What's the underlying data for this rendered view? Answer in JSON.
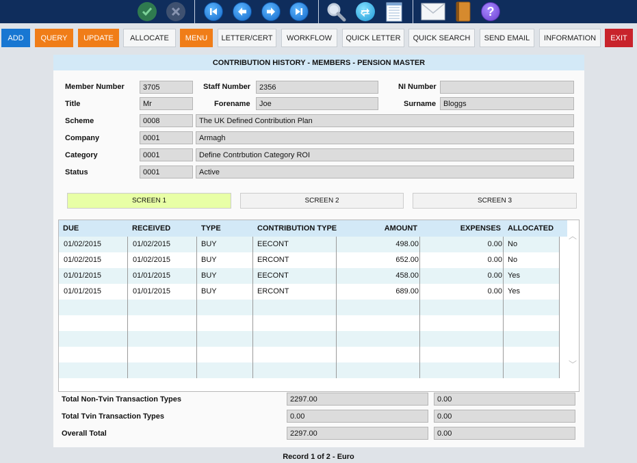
{
  "toolbar_icons": [
    "confirm-icon",
    "cancel-icon",
    "first-record-icon",
    "previous-record-icon",
    "next-record-icon",
    "last-record-icon",
    "search-icon",
    "refresh-icon",
    "notepad-icon",
    "mail-icon",
    "address-book-icon",
    "help-icon"
  ],
  "buttons": {
    "add": "ADD",
    "query": "QUERY",
    "update": "UPDATE",
    "allocate": "ALLOCATE",
    "menu": "MENU",
    "letter_cert": "LETTER/CERT",
    "workflow": "WORKFLOW",
    "quick_letter": "QUICK LETTER",
    "quick_search": "QUICK SEARCH",
    "send_email": "SEND EMAIL",
    "information": "INFORMATION",
    "exit": "EXIT"
  },
  "colors": {
    "toolbar_bg": "#0f2d5c",
    "accent_blue": "#1877d2",
    "accent_orange": "#f07d18",
    "accent_red": "#c8232b",
    "header_blue": "#d3e9f7",
    "active_tab": "#e8ffa6"
  },
  "panel": {
    "title": "CONTRIBUTION HISTORY - MEMBERS - PENSION MASTER"
  },
  "member": {
    "member_number_label": "Member Number",
    "member_number": "3705",
    "staff_number_label": "Staff Number",
    "staff_number": "2356",
    "ni_number_label": "NI Number",
    "ni_number": "",
    "title_label": "Title",
    "title": "Mr",
    "forename_label": "Forename",
    "forename": "Joe",
    "surname_label": "Surname",
    "surname": "Bloggs",
    "scheme_label": "Scheme",
    "scheme_code": "0008",
    "scheme_name": "The UK Defined Contribution Plan",
    "company_label": "Company",
    "company_code": "0001",
    "company_name": "Armagh",
    "category_label": "Category",
    "category_code": "0001",
    "category_name": "Define Contrbution Category ROI",
    "status_label": "Status",
    "status_code": "0001",
    "status_name": "Active"
  },
  "tabs": [
    "SCREEN 1",
    "SCREEN 2",
    "SCREEN 3"
  ],
  "grid": {
    "headers": [
      "DUE",
      "RECEIVED",
      "TYPE",
      "CONTRIBUTION TYPE",
      "AMOUNT",
      "EXPENSES",
      "ALLOCATED"
    ],
    "rows": [
      [
        "01/02/2015",
        "01/02/2015",
        "BUY",
        "EECONT",
        "498.00",
        "0.00",
        "No"
      ],
      [
        "01/02/2015",
        "01/02/2015",
        "BUY",
        "ERCONT",
        "652.00",
        "0.00",
        "No"
      ],
      [
        "01/01/2015",
        "01/01/2015",
        "BUY",
        "EECONT",
        "458.00",
        "0.00",
        "Yes"
      ],
      [
        "01/01/2015",
        "01/01/2015",
        "BUY",
        "ERCONT",
        "689.00",
        "0.00",
        "Yes"
      ]
    ]
  },
  "totals": {
    "non_tvin_label": "Total Non-Tvin Transaction Types",
    "non_tvin_amount": "2297.00",
    "non_tvin_expenses": "0.00",
    "tvin_label": "Total Tvin Transaction Types",
    "tvin_amount": "0.00",
    "tvin_expenses": "0.00",
    "overall_label": "Overall Total",
    "overall_amount": "2297.00",
    "overall_expenses": "0.00"
  },
  "footer": {
    "record_text": "Record 1 of 2 - Euro"
  }
}
